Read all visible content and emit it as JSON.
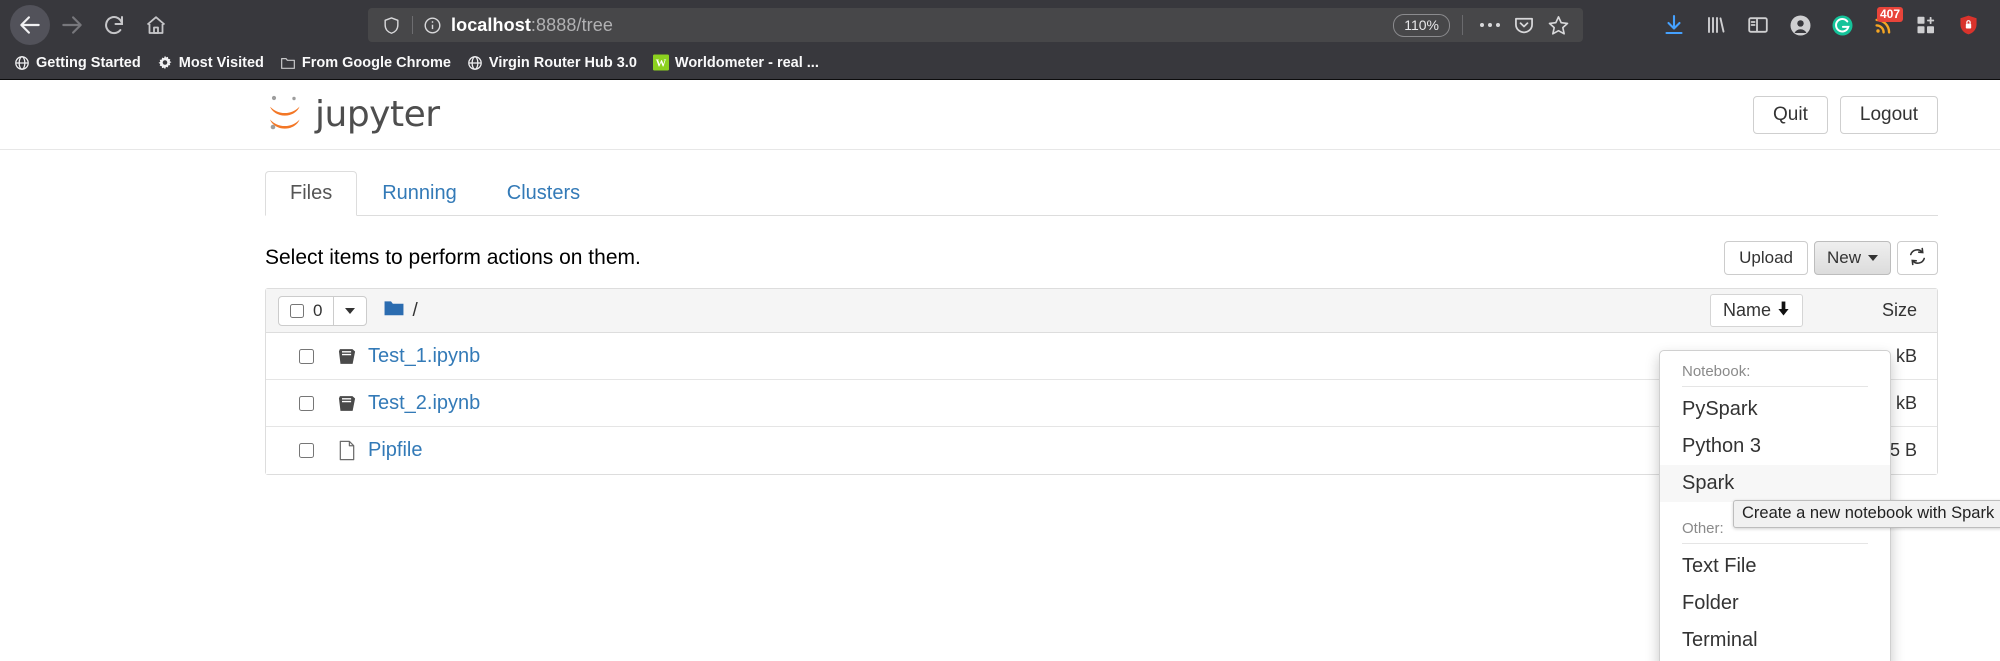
{
  "browser": {
    "nav": {
      "back_icon": "arrow-left-icon",
      "forward_icon": "arrow-right-icon",
      "reload_icon": "reload-icon",
      "home_icon": "home-icon"
    },
    "urlbar": {
      "shield_icon": "shield-icon",
      "info_icon": "info-circle-icon",
      "host": "localhost",
      "path": ":8888/tree",
      "zoom_level": "110%",
      "more_icon": "ellipsis-icon",
      "pocket_icon": "pocket-icon",
      "bookmark_icon": "star-icon"
    },
    "toolbar_right": [
      {
        "name": "downloads-icon",
        "glyph": "↓",
        "color": "#45a1ff"
      },
      {
        "name": "library-icon",
        "glyph": "",
        "color": "#cfcfd1"
      },
      {
        "name": "sidebar-icon",
        "glyph": "",
        "color": "#cfcfd1"
      },
      {
        "name": "account-icon",
        "glyph": "",
        "color": "#cfcfd1"
      },
      {
        "name": "grammarly-icon",
        "glyph": "G",
        "color": "#15c39a"
      },
      {
        "name": "rss-feed-icon",
        "glyph": "",
        "color": "#f5a623",
        "badge": "407"
      },
      {
        "name": "extensions-icon",
        "glyph": "",
        "color": "#cfcfd1"
      },
      {
        "name": "lock-extension-icon",
        "glyph": "",
        "color": "#d33"
      }
    ],
    "bookmarks": [
      {
        "label": "Getting Started",
        "icon": "globe-icon"
      },
      {
        "label": "Most Visited",
        "icon": "gear-icon"
      },
      {
        "label": "From Google Chrome",
        "icon": "folder-icon"
      },
      {
        "label": "Virgin Router Hub 3.0",
        "icon": "globe-icon"
      },
      {
        "label": "Worldometer - real ...",
        "icon": "worldometer-icon"
      }
    ]
  },
  "jupyter": {
    "logo_text": "jupyter",
    "header_buttons": [
      {
        "label": "Quit",
        "name": "quit-button"
      },
      {
        "label": "Logout",
        "name": "logout-button"
      }
    ],
    "tabs": [
      {
        "label": "Files",
        "active": true
      },
      {
        "label": "Running",
        "active": false
      },
      {
        "label": "Clusters",
        "active": false
      }
    ],
    "select_hint": "Select items to perform actions on them.",
    "toolbar": {
      "upload_label": "Upload",
      "new_label": "New",
      "refresh_icon": "refresh-icon"
    },
    "list_header": {
      "selected_count": "0",
      "breadcrumb_root": "/",
      "folder_icon": "folder-icon",
      "sort_label": "Name",
      "sort_direction_icon": "arrow-down-icon",
      "size_column_label": "Size"
    },
    "files": [
      {
        "name": "Test_1.ipynb",
        "icon": "notebook-icon",
        "size": "kB"
      },
      {
        "name": "Test_2.ipynb",
        "icon": "notebook-icon",
        "size": "kB"
      },
      {
        "name": "Pipfile",
        "icon": "file-icon",
        "size": "5 B"
      }
    ],
    "new_menu": {
      "notebook_label": "Notebook:",
      "notebook_items": [
        {
          "label": "PySpark",
          "highlight": false
        },
        {
          "label": "Python 3",
          "highlight": false
        },
        {
          "label": "Spark",
          "highlight": true
        }
      ],
      "other_label": "Other:",
      "other_items": [
        {
          "label": "Text File",
          "highlight": false
        },
        {
          "label": "Folder",
          "highlight": false
        },
        {
          "label": "Terminal",
          "highlight": false
        }
      ]
    },
    "tooltip": "Create a new notebook with Spark"
  },
  "colors": {
    "link": "#337ab7",
    "jupyter_orange": "#f37726",
    "chrome_bg": "#38383d",
    "badge_red": "#e8443a"
  }
}
